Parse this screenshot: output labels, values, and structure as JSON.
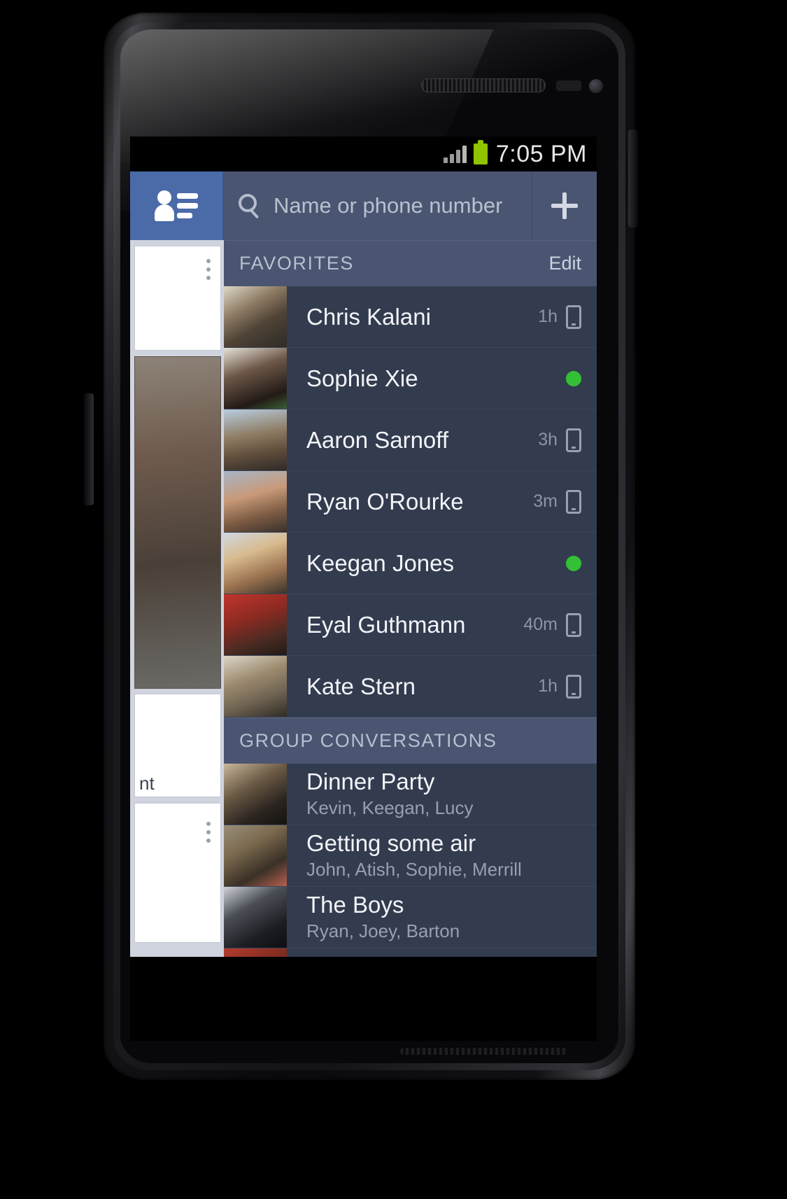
{
  "device": {
    "earpiece": "earpiece-speaker",
    "front_camera": "front-camera",
    "proximity_sensor": "proximity-sensor"
  },
  "status_bar": {
    "time": "7:05 PM",
    "signal_icon": "signal-bars-icon",
    "battery_icon": "battery-full-icon",
    "battery_color": "#8fc400"
  },
  "action_bar": {
    "app_icon": "contacts-icon",
    "search": {
      "icon": "search-icon",
      "placeholder": "Name or phone number",
      "value": ""
    },
    "add_button": {
      "icon": "plus-icon",
      "label": "+"
    },
    "tile_color": "#4a6ba8",
    "bar_color": "#4a5571"
  },
  "peek_panel": {
    "visible_text": "nt",
    "overflow_icon": "more-vertical-icon"
  },
  "sections": [
    {
      "id": "favorites",
      "title": "FAVORITES",
      "action": "Edit",
      "rows": [
        {
          "name": "Chris Kalani",
          "ago": "1h",
          "status": "phone",
          "avatar": "av-chris"
        },
        {
          "name": "Sophie Xie",
          "ago": "",
          "status": "online",
          "avatar": "av-sophie"
        },
        {
          "name": "Aaron Sarnoff",
          "ago": "3h",
          "status": "phone",
          "avatar": "av-aaron"
        },
        {
          "name": "Ryan O'Rourke",
          "ago": "3m",
          "status": "phone",
          "avatar": "av-ryan"
        },
        {
          "name": "Keegan Jones",
          "ago": "",
          "status": "online",
          "avatar": "av-keegan"
        },
        {
          "name": "Eyal Guthmann",
          "ago": "40m",
          "status": "phone",
          "avatar": "av-eyal"
        },
        {
          "name": "Kate Stern",
          "ago": "1h",
          "status": "phone",
          "avatar": "av-kate"
        }
      ]
    },
    {
      "id": "group-conversations",
      "title": "GROUP CONVERSATIONS",
      "action": "",
      "rows": [
        {
          "name": "Dinner Party",
          "sub": "Kevin, Keegan, Lucy",
          "avatar": "av-dinner"
        },
        {
          "name": "Getting some air",
          "sub": "John, Atish, Sophie, Merrill",
          "avatar": "av-air"
        },
        {
          "name": "The Boys",
          "sub": "Ryan, Joey, Barton",
          "avatar": "av-boys"
        }
      ]
    }
  ],
  "colors": {
    "online_green": "#34c034",
    "row_bg": "#333c4e",
    "section_bg": "#4b5571",
    "accent_blue": "#4a6ba8"
  }
}
